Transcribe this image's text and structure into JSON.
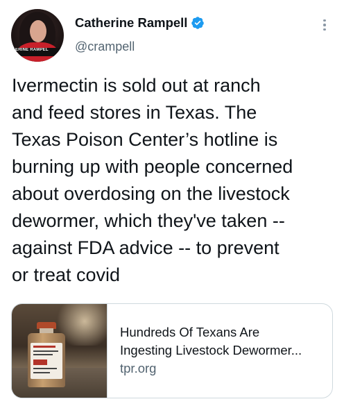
{
  "author": {
    "display_name": "Catherine Rampell",
    "handle": "@crampell",
    "avatar_chyron": "ERINE RAMPEL",
    "verified_color": "#1d9bf0"
  },
  "tweet": {
    "text": "Ivermectin is sold out at ranch\nand feed stores in Texas. The\nTexas Poison Center’s hotline is\nburning up with people concerned\nabout overdosing on the livestock\ndewormer, which they've taken --\nagainst FDA advice -- to prevent\nor treat covid"
  },
  "link_card": {
    "title_line1": "Hundreds Of Texans Are",
    "title_line2": "Ingesting Livestock Dewormer...",
    "domain": "tpr.org"
  }
}
